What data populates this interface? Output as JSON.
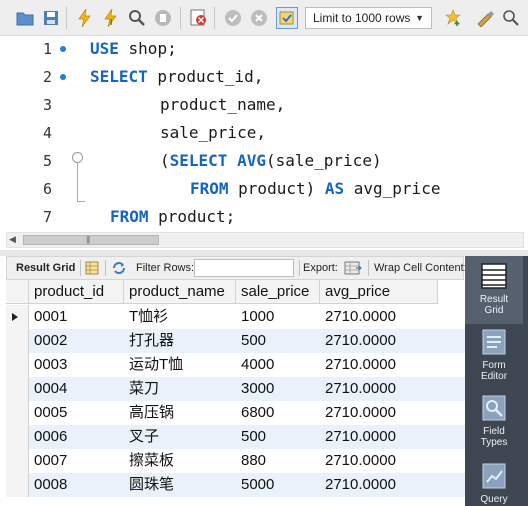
{
  "toolbar": {
    "limit_select": "Limit to 1000 rows",
    "icons": [
      "open-folder-icon",
      "save-icon",
      "execute-icon",
      "execute-current-icon",
      "explain-icon",
      "stop-icon",
      "toggle-error-icon",
      "commit-icon",
      "rollback-icon",
      "autocommit-icon",
      "add-snippet-icon",
      "beautify-icon",
      "find-icon"
    ]
  },
  "editor": {
    "lines": [
      {
        "num": "1",
        "tokens": [
          {
            "t": "USE",
            "k": true
          },
          {
            "t": " shop;",
            "k": false
          }
        ]
      },
      {
        "num": "2",
        "tokens": [
          {
            "t": "SELECT",
            "k": true
          },
          {
            "t": " product_id,",
            "k": false
          }
        ]
      },
      {
        "num": "3",
        "tokens": [
          {
            "t": "product_name,",
            "k": false
          }
        ]
      },
      {
        "num": "4",
        "tokens": [
          {
            "t": "sale_price,",
            "k": false
          }
        ]
      },
      {
        "num": "5",
        "tokens": [
          {
            "t": "(",
            "k": false
          },
          {
            "t": "SELECT",
            "k": true
          },
          {
            "t": " ",
            "k": false
          },
          {
            "t": "AVG",
            "k": true
          },
          {
            "t": "(sale_price)",
            "k": false
          }
        ]
      },
      {
        "num": "6",
        "tokens": [
          {
            "t": "FROM",
            "k": true
          },
          {
            "t": " product) ",
            "k": false
          },
          {
            "t": "AS",
            "k": true
          },
          {
            "t": " avg_price",
            "k": false
          }
        ]
      },
      {
        "num": "7",
        "tokens": [
          {
            "t": "FROM",
            "k": true
          },
          {
            "t": " product;",
            "k": false
          }
        ]
      }
    ]
  },
  "result_toolbar": {
    "result_grid": "Result Grid",
    "filter_rows": "Filter Rows:",
    "export": "Export:",
    "wrap_cell": "Wrap Cell Content:",
    "filter_value": ""
  },
  "grid": {
    "columns": [
      "product_id",
      "product_name",
      "sale_price",
      "avg_price"
    ],
    "rows": [
      [
        "0001",
        "T恤衫",
        "1000",
        "2710.0000"
      ],
      [
        "0002",
        "打孔器",
        "500",
        "2710.0000"
      ],
      [
        "0003",
        "运动T恤",
        "4000",
        "2710.0000"
      ],
      [
        "0004",
        "菜刀",
        "3000",
        "2710.0000"
      ],
      [
        "0005",
        "高压锅",
        "6800",
        "2710.0000"
      ],
      [
        "0006",
        "叉子",
        "500",
        "2710.0000"
      ],
      [
        "0007",
        "擦菜板",
        "880",
        "2710.0000"
      ],
      [
        "0008",
        "圆珠笔",
        "5000",
        "2710.0000"
      ]
    ]
  },
  "side_panel": {
    "result_grid": "Result Grid",
    "form_editor": "Form Editor",
    "field_types": "Field Types",
    "query": "Query"
  }
}
